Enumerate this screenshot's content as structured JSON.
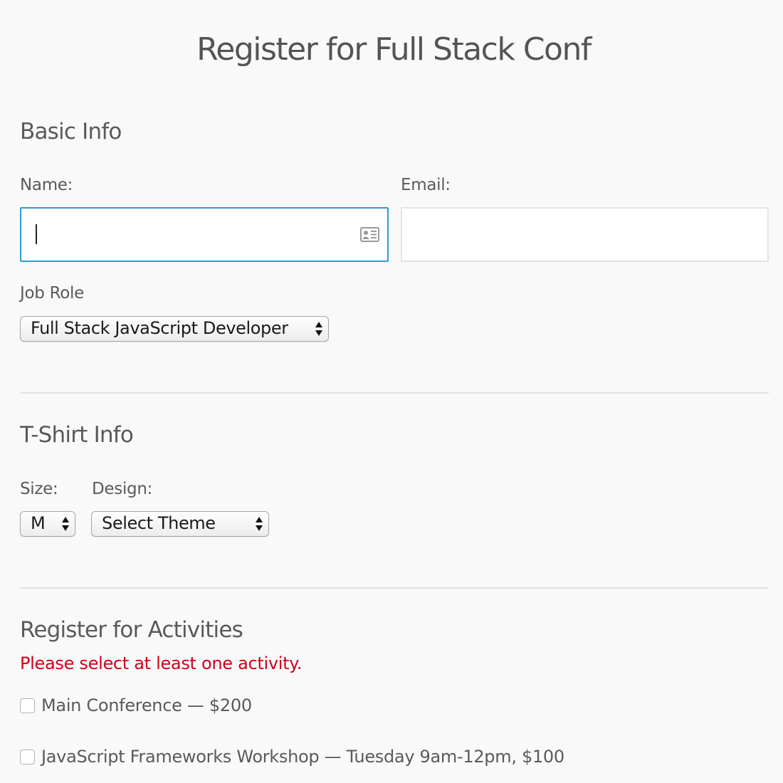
{
  "title": "Register for Full Stack Conf",
  "basic_info": {
    "heading": "Basic Info",
    "name_label": "Name:",
    "name_value": "",
    "email_label": "Email:",
    "email_value": "",
    "job_role_label": "Job Role",
    "job_role_selected": "Full Stack JavaScript Developer"
  },
  "tshirt_info": {
    "heading": "T-Shirt Info",
    "size_label": "Size:",
    "size_selected": "M",
    "design_label": "Design:",
    "design_selected": "Select Theme"
  },
  "activities": {
    "heading": "Register for Activities",
    "error_message": "Please select at least one activity.",
    "items": [
      {
        "label": "Main Conference — $200",
        "checked": false
      },
      {
        "label": "JavaScript Frameworks Workshop — Tuesday 9am-12pm, $100",
        "checked": false
      }
    ]
  },
  "colors": {
    "focus_border": "#2e9bd6",
    "error": "#d0011b",
    "text": "#5a5a5a"
  },
  "icons": {
    "name_field_icon": "contact-card-icon",
    "select_arrows": "updown-arrows-icon"
  }
}
